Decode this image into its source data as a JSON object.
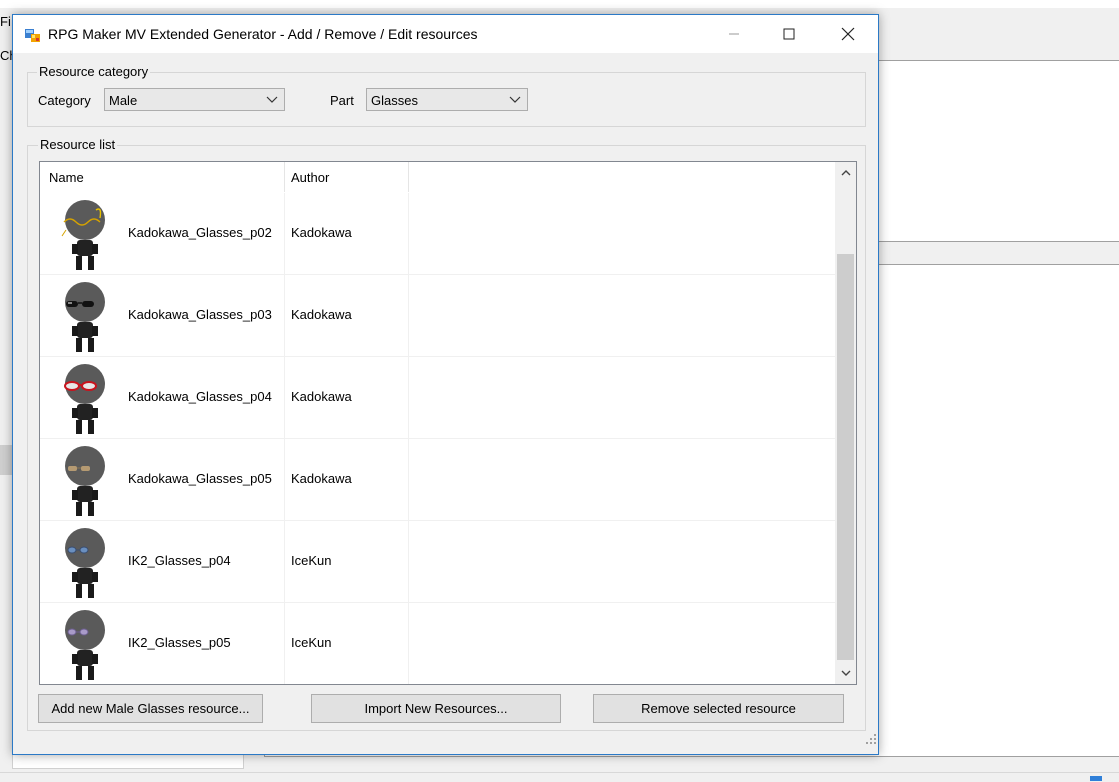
{
  "background": {
    "menu_fragment": "Fi",
    "tab_fragment": "Ch"
  },
  "dialog": {
    "title": "RPG Maker MV Extended Generator - Add / Remove / Edit resources",
    "controls": {
      "minimize": "—",
      "maximize": "☐",
      "close": "✕"
    }
  },
  "resource_category": {
    "legend": "Resource category",
    "category_label": "Category",
    "category_value": "Male",
    "part_label": "Part",
    "part_value": "Glasses"
  },
  "resource_list": {
    "legend": "Resource list",
    "columns": {
      "name": "Name",
      "author": "Author"
    },
    "rows": [
      {
        "name": "Kadokawa_Glasses_p02",
        "author": "Kadokawa",
        "glasses": "gold-wire"
      },
      {
        "name": "Kadokawa_Glasses_p03",
        "author": "Kadokawa",
        "glasses": "black-sunglasses"
      },
      {
        "name": "Kadokawa_Glasses_p04",
        "author": "Kadokawa",
        "glasses": "red-frame"
      },
      {
        "name": "Kadokawa_Glasses_p05",
        "author": "Kadokawa",
        "glasses": "tan-lenses"
      },
      {
        "name": "IK2_Glasses_p04",
        "author": "IceKun",
        "glasses": "blue-lenses"
      },
      {
        "name": "IK2_Glasses_p05",
        "author": "IceKun",
        "glasses": "lilac-lenses"
      }
    ]
  },
  "buttons": {
    "add": "Add new Male Glasses resource...",
    "import": "Import New Resources...",
    "remove": "Remove selected resource"
  },
  "colors": {
    "accent_border": "#2b79c6",
    "window_bg": "#f0f0f0"
  }
}
